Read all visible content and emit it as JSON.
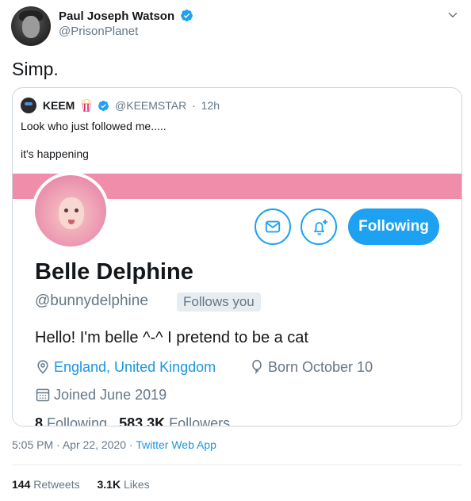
{
  "author": {
    "name": "Paul Joseph Watson",
    "handle": "@PrisonPlanet"
  },
  "tweet": {
    "text": "Simp."
  },
  "quoted_tweet": {
    "name": "KEEM",
    "handle": "@KEEMSTAR",
    "separator": "·",
    "time": "12h",
    "line1": "Look who just followed me.....",
    "line2": "it's happening"
  },
  "profile_screenshot": {
    "display_name": "Belle Delphine",
    "handle": "@bunnydelphine",
    "follows_you": "Follows you",
    "following_button": "Following",
    "bio": "Hello! I'm belle ^-^ I pretend to be a cat",
    "location": "England, United Kingdom",
    "born": "Born October 10",
    "joined": "Joined June 2019",
    "following_count": "8",
    "following_label": "Following",
    "followers_count": "583.3K",
    "followers_label": "Followers",
    "banner_color": "#f08daa"
  },
  "footer": {
    "time": "5:05 PM",
    "separator": "·",
    "date": "Apr 22, 2020",
    "app": "Twitter Web App",
    "retweets_count": "144",
    "retweets_label": "Retweets",
    "likes_count": "3.1K",
    "likes_label": "Likes"
  },
  "colors": {
    "accent": "#1da1f2",
    "link": "#1b95e0",
    "muted": "#657786"
  }
}
